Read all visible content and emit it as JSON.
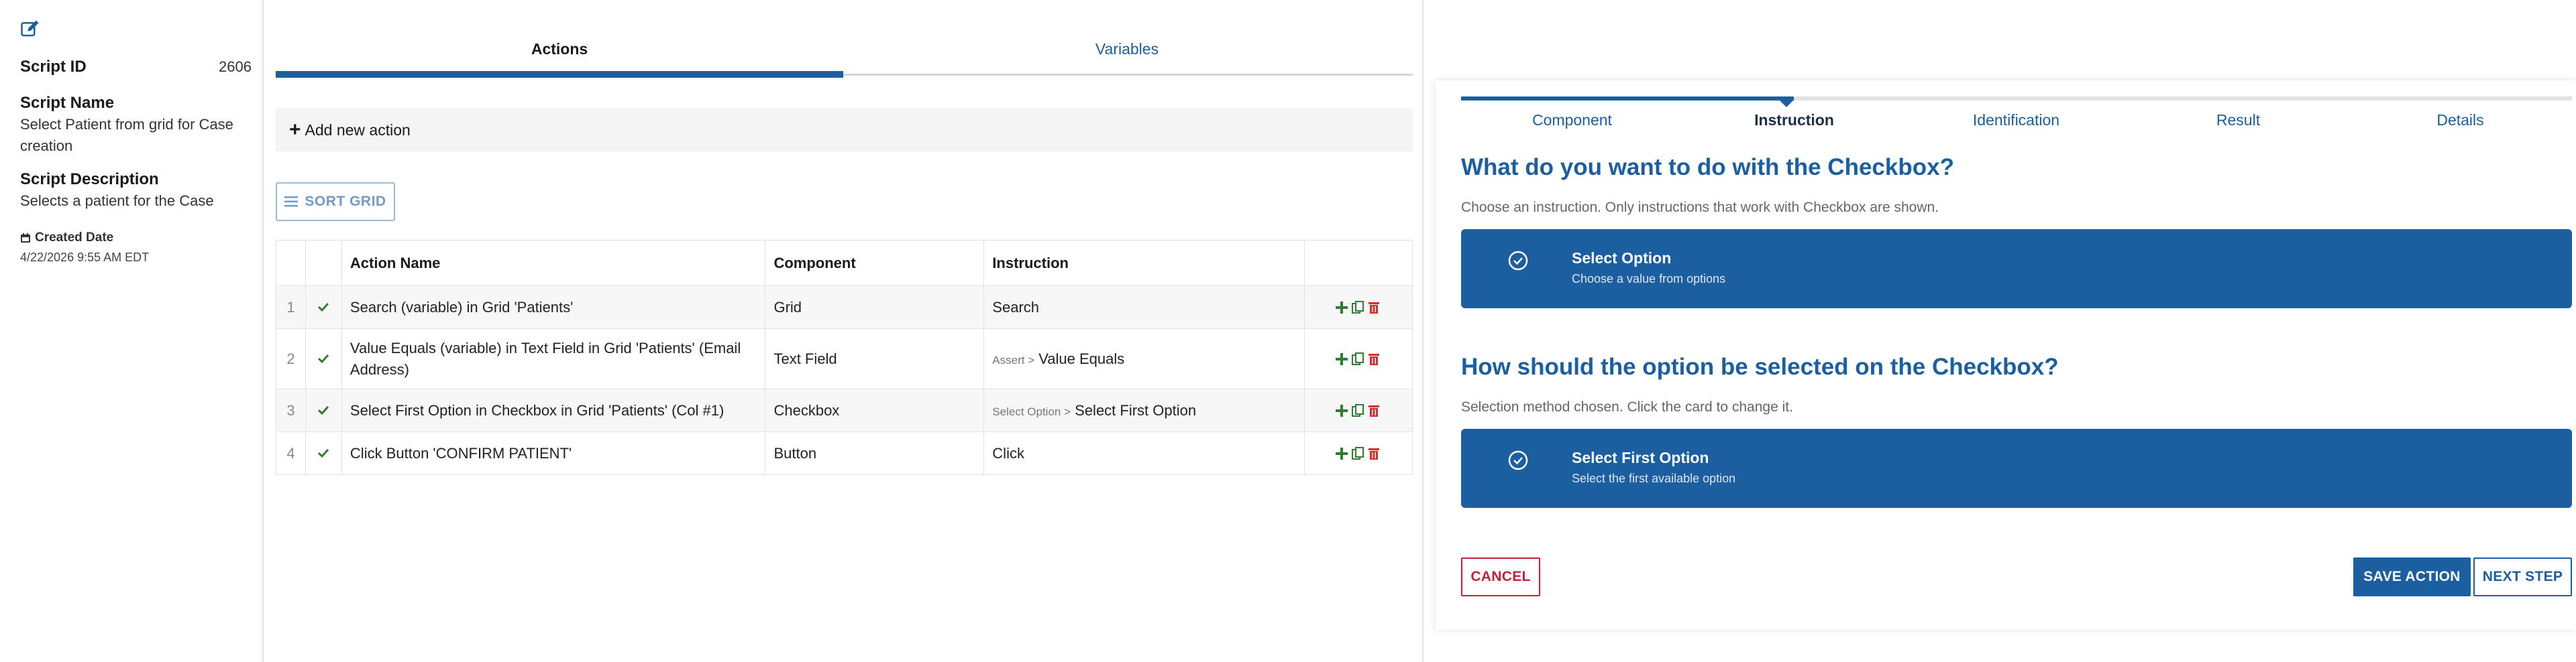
{
  "script": {
    "id_label": "Script ID",
    "id_value": "2606",
    "name_label": "Script Name",
    "name_value": "Select Patient from grid for Case creation",
    "description_label": "Script Description",
    "description_value": "Selects a patient for the Case",
    "created_label": "Created Date",
    "created_value": "4/22/2026 9:55 AM EDT"
  },
  "tabs": {
    "actions": "Actions",
    "variables": "Variables"
  },
  "toolbar": {
    "add_action": "Add new action",
    "sort_grid": "SORT GRID"
  },
  "grid": {
    "headers": {
      "action_name": "Action Name",
      "component": "Component",
      "instruction": "Instruction"
    },
    "rows": [
      {
        "num": "1",
        "name": "Search (variable) in Grid 'Patients'",
        "component": "Grid",
        "prefix": "",
        "instruction": "Search"
      },
      {
        "num": "2",
        "name": "Value Equals (variable) in Text Field in Grid 'Patients' (Email Address)",
        "component": "Text Field",
        "prefix": "Assert >",
        "instruction": "Value Equals"
      },
      {
        "num": "3",
        "name": "Select First Option in Checkbox in Grid 'Patients' (Col #1)",
        "component": "Checkbox",
        "prefix": "Select Option >",
        "instruction": "Select First Option"
      },
      {
        "num": "4",
        "name": "Click Button 'CONFIRM PATIENT'",
        "component": "Button",
        "prefix": "",
        "instruction": "Click"
      }
    ]
  },
  "wizard": {
    "steps": [
      "Component",
      "Instruction",
      "Identification",
      "Result",
      "Details"
    ],
    "active_step": "Instruction",
    "q1": {
      "title": "What do you want to do with the Checkbox?",
      "subtitle": "Choose an instruction. Only instructions that work with Checkbox are shown.",
      "card_title": "Select Option",
      "card_desc": "Choose a value from options"
    },
    "q2": {
      "title": "How should the option be selected on the Checkbox?",
      "subtitle": "Selection method chosen. Click the card to change it.",
      "card_title": "Select First Option",
      "card_desc": "Select the first available option"
    },
    "buttons": {
      "cancel": "CANCEL",
      "save": "SAVE ACTION",
      "next": "NEXT STEP"
    }
  },
  "colors": {
    "primary": "#1c5fa0",
    "danger": "#c61f3c",
    "success": "#2e7d32",
    "delete": "#d32f2f"
  },
  "icons": {
    "edit": "edit-icon",
    "calendar": "calendar-icon",
    "plus": "plus-icon",
    "sort": "sort-lines-icon",
    "check": "check-icon",
    "copy": "copy-icon",
    "trash": "trash-icon",
    "circle_check": "circle-check-icon"
  }
}
